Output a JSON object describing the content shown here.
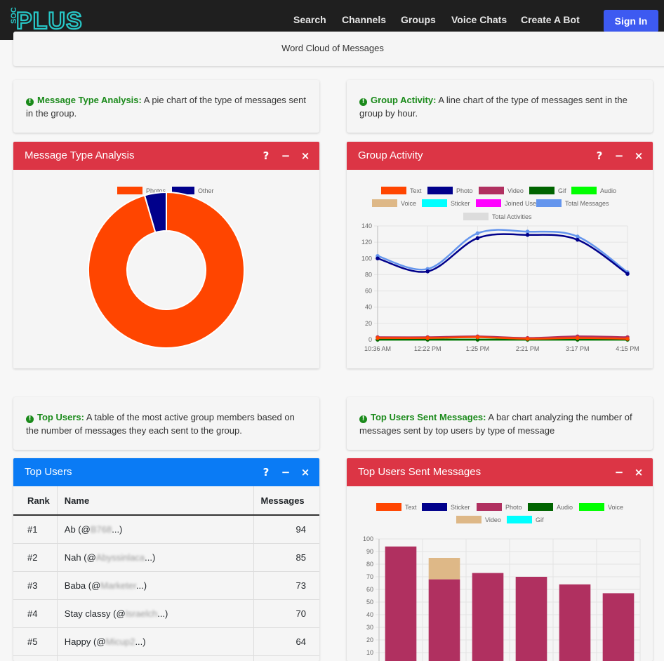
{
  "nav": {
    "logo_top": "SOC",
    "logo_main": "PLUS",
    "links": [
      "Search",
      "Channels",
      "Groups",
      "Voice Chats",
      "Create A Bot"
    ],
    "signin": "Sign In"
  },
  "word_cloud": {
    "label": "Word Cloud of Messages"
  },
  "info": {
    "message_type": {
      "title": "Message Type Analysis:",
      "text": "A pie chart of the type of messages sent in the group."
    },
    "group_activity": {
      "title": "Group Activity:",
      "text": "A line chart of the type of messages sent in the group by hour."
    },
    "top_users": {
      "title": "Top Users:",
      "text": "A table of the most active group members based on the number of messages they each sent to the group."
    },
    "top_users_sent": {
      "title": "Top Users Sent Messages:",
      "text": "A bar chart analyzing the number of messages sent by top users by type of message"
    }
  },
  "panels": {
    "message_type": {
      "title": "Message Type Analysis",
      "help": "?",
      "minimize": "−",
      "close": "×"
    },
    "group_activity": {
      "title": "Group Activity",
      "help": "?",
      "minimize": "−",
      "close": "×"
    },
    "top_users": {
      "title": "Top Users",
      "help": "?",
      "minimize": "−",
      "close": "×"
    },
    "top_users_sent": {
      "title": "Top Users Sent Messages",
      "minimize": "−",
      "close": "×"
    }
  },
  "top_users_table": {
    "headers": [
      "Rank",
      "Name",
      "Messages"
    ],
    "rows": [
      {
        "rank": "#1",
        "name_pre": "Ab (@",
        "name_blur": "B768",
        "name_post": "...)",
        "messages": "94"
      },
      {
        "rank": "#2",
        "name_pre": "Nah (@",
        "name_blur": "Abyssinlaca",
        "name_post": "...)",
        "messages": "85"
      },
      {
        "rank": "#3",
        "name_pre": "Baba (@",
        "name_blur": "Marketer",
        "name_post": "...)",
        "messages": "73"
      },
      {
        "rank": "#4",
        "name_pre": "Stay classy (@",
        "name_blur": "Israelch",
        "name_post": "...)",
        "messages": "70"
      },
      {
        "rank": "#5",
        "name_pre": "Happy (@",
        "name_blur": "Micup2",
        "name_post": "...)",
        "messages": "64"
      }
    ]
  },
  "chart_data": [
    {
      "type": "pie",
      "title": "Message Type Analysis",
      "donut": true,
      "legend": "top",
      "slices": [
        {
          "name": "Photos",
          "value": 95.5,
          "color": "#ff4500"
        },
        {
          "name": "Other",
          "value": 4.5,
          "color": "#00008b"
        }
      ]
    },
    {
      "type": "line",
      "title": "Group Activity",
      "legend": "top",
      "categories": [
        "10:36 AM",
        "12:22 PM",
        "1:25 PM",
        "2:21 PM",
        "3:17 PM",
        "4:15 PM"
      ],
      "ylim": [
        0,
        140
      ],
      "yticks": [
        0,
        20,
        40,
        60,
        80,
        100,
        120,
        140
      ],
      "grid": true,
      "series": [
        {
          "name": "Text",
          "color": "#ff4500",
          "values": [
            2,
            2,
            3,
            1,
            2,
            1
          ]
        },
        {
          "name": "Photo",
          "color": "#00008b",
          "values": [
            100,
            84,
            125,
            129,
            123,
            81
          ]
        },
        {
          "name": "Video",
          "color": "#b03060",
          "values": [
            3,
            3,
            4,
            2,
            4,
            3
          ]
        },
        {
          "name": "Gif",
          "color": "#006400",
          "values": [
            0,
            0,
            0,
            0,
            0,
            0
          ]
        },
        {
          "name": "Audio",
          "color": "#00ff00",
          "values": [
            0,
            0,
            0,
            0,
            0,
            0
          ]
        },
        {
          "name": "Voice",
          "color": "#deb887",
          "values": [
            0,
            0,
            0,
            0,
            0,
            0
          ]
        },
        {
          "name": "Sticker",
          "color": "#00ffff",
          "values": [
            0,
            0,
            0,
            0,
            0,
            0
          ]
        },
        {
          "name": "Joined Users",
          "color": "#ff00ff",
          "values": [
            0,
            0,
            0,
            0,
            0,
            0
          ]
        },
        {
          "name": "Total Messages",
          "color": "#6495ed",
          "values": [
            103,
            87,
            131,
            133,
            127,
            83
          ]
        },
        {
          "name": "Total Activities",
          "color": "#dcdcdc",
          "values": []
        }
      ]
    },
    {
      "type": "bar",
      "title": "Top Users Sent Messages",
      "stacked": true,
      "legend": "top",
      "ylim": [
        0,
        100
      ],
      "yticks": [
        0,
        10,
        20,
        30,
        40,
        50,
        60,
        70,
        80,
        90,
        100
      ],
      "grid": true,
      "categories": [
        "",
        "",
        "",
        "",
        "",
        ""
      ],
      "series": [
        {
          "name": "Text",
          "color": "#ff4500",
          "values": [
            0,
            0,
            0,
            0,
            0,
            0
          ]
        },
        {
          "name": "Sticker",
          "color": "#00008b",
          "values": [
            0,
            0,
            0,
            0,
            0,
            0
          ]
        },
        {
          "name": "Photo",
          "color": "#b03060",
          "values": [
            94,
            68,
            73,
            70,
            64,
            57
          ]
        },
        {
          "name": "Audio",
          "color": "#006400",
          "values": [
            0,
            0,
            0,
            0,
            0,
            0
          ]
        },
        {
          "name": "Voice",
          "color": "#00ff00",
          "values": [
            0,
            0,
            0,
            0,
            0,
            0
          ]
        },
        {
          "name": "Video",
          "color": "#deb887",
          "values": [
            0,
            17,
            0,
            0,
            0,
            0
          ]
        },
        {
          "name": "Gif",
          "color": "#00ffff",
          "values": [
            0,
            0,
            0,
            0,
            0,
            0
          ]
        }
      ]
    }
  ]
}
